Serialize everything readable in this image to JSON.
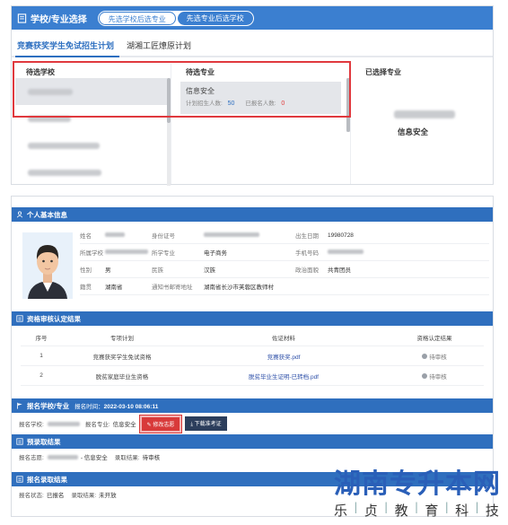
{
  "selection": {
    "title": "学校/专业选择",
    "toggle": [
      "先选学校后选专业",
      "先选专业后选学校"
    ],
    "tabs": [
      "竞赛获奖学生免试招生计划",
      "湖湘工匠燎原计划"
    ],
    "col_school_title": "待选学校",
    "col_major_title": "待选专业",
    "col_chosen_title": "已选择专业",
    "major": {
      "name": "信息安全",
      "plan_label": "计划招生人数:",
      "plan_value": "50",
      "applied_label": "已报名人数:",
      "applied_value": "0"
    },
    "chosen_major": "信息安全"
  },
  "profile": {
    "basic_title": "个人基本信息",
    "fields": {
      "name_label": "姓名",
      "id_label": "身份证号",
      "birth_label": "出生日期",
      "birth_value": "19980728",
      "school_label": "所属学校",
      "major_label": "所学专业",
      "major_value": "电子商务",
      "phone_label": "手机号码",
      "gender_label": "性别",
      "gender_value": "男",
      "ethnic_label": "民族",
      "ethnic_value": "汉族",
      "politics_label": "政治面貌",
      "politics_value": "共青团员",
      "origin_label": "籍贯",
      "origin_value": "湖南省",
      "address_label": "通知书邮寄地址",
      "address_value": "湖南省长沙市芙蓉区教师村"
    },
    "qual_title": "资格审核认定结果",
    "table_headers": [
      "序号",
      "专项计划",
      "佐证材料",
      "资格认定结果"
    ],
    "table_rows": [
      {
        "no": "1",
        "plan": "竞赛获奖学生免试资格",
        "file": "竞赛获奖.pdf",
        "status": "待审核"
      },
      {
        "no": "2",
        "plan": "脱贫家庭毕业生资格",
        "file": "脱贫毕业生证明-已转档.pdf",
        "status": "待审核"
      }
    ],
    "apply_title": "报名学校/专业",
    "apply_time_label": "报名时间：",
    "apply_time_value": "2022-03-10 08:06:11",
    "apply_school_label": "报名学校:",
    "apply_major_label": "报名专业:",
    "apply_major_value": "信息安全",
    "btn_modify": "修改志愿",
    "btn_download": "下载准考证",
    "pre_title": "预录取结果",
    "pre_label": "报名志愿:",
    "pre_major": "- 信息安全",
    "pre_result_label": "录取结果:",
    "pre_result_value": "待审核",
    "final_title": "报名录取结果",
    "final_status_label": "报名状态:",
    "final_status_value": "已报名",
    "final_result_label": "录取结果:",
    "final_result_value": "未开放"
  },
  "watermark": {
    "title": "湖南专升本网",
    "sub": [
      "乐",
      "贞",
      "教",
      "育",
      "科",
      "技"
    ]
  },
  "colors": {
    "primary": "#3b7fd0",
    "section": "#2f6fbe",
    "highlight_red": "#e0393e",
    "watermark": "#2a5fb8"
  }
}
